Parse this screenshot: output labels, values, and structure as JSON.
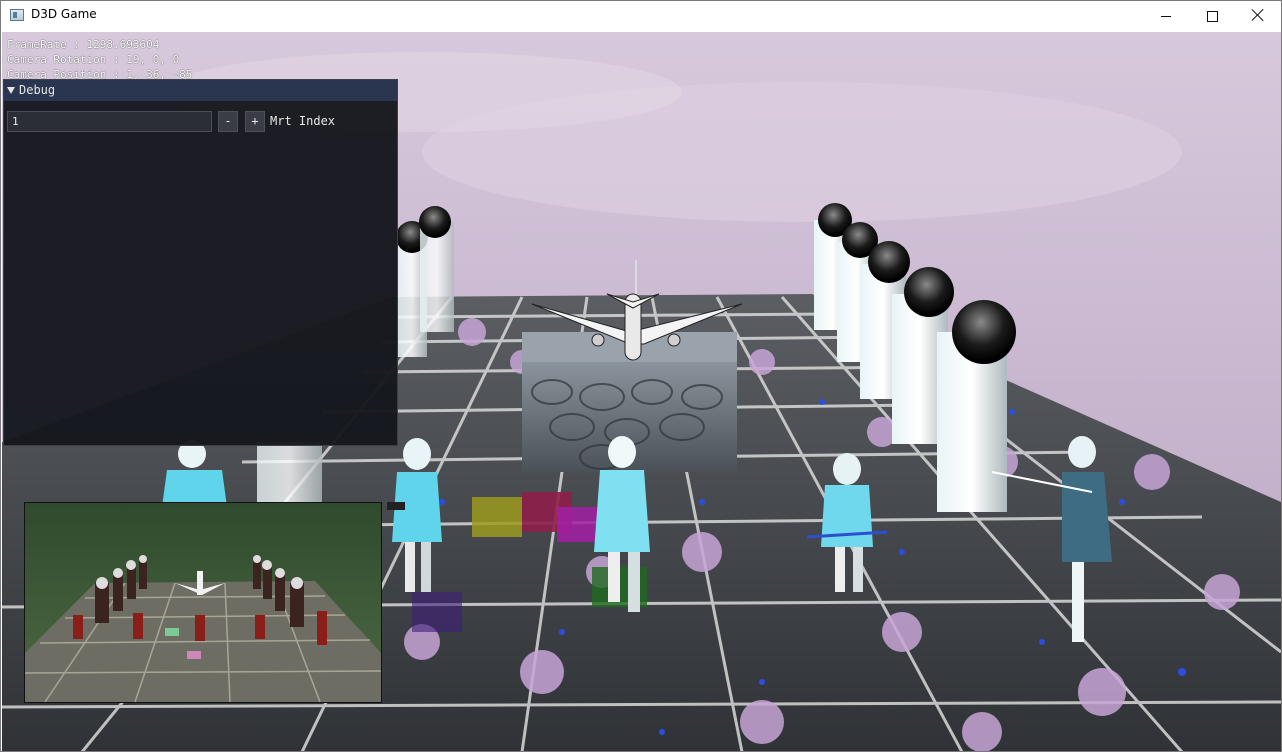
{
  "window": {
    "title": "D3D Game",
    "minimize_label": "minimize",
    "maximize_label": "maximize",
    "close_label": "close"
  },
  "hud": {
    "framerate": "FrameRate : 1298.693604",
    "camera_rotation": "Camera Rotation : 19, 0, 0",
    "camera_position": "Camera Position : 1, 36, -85"
  },
  "debug_panel": {
    "title": "Debug",
    "mrt_index_value": "1",
    "minus_label": "-",
    "plus_label": "+",
    "mrt_index_label": "Mrt Index"
  },
  "colors": {
    "debug_header": "#2a3550",
    "debug_body": "#16181e",
    "sky": "#c9b9cf",
    "floor_tile": "#3c3f44",
    "grid_line": "#d8d8d8"
  }
}
